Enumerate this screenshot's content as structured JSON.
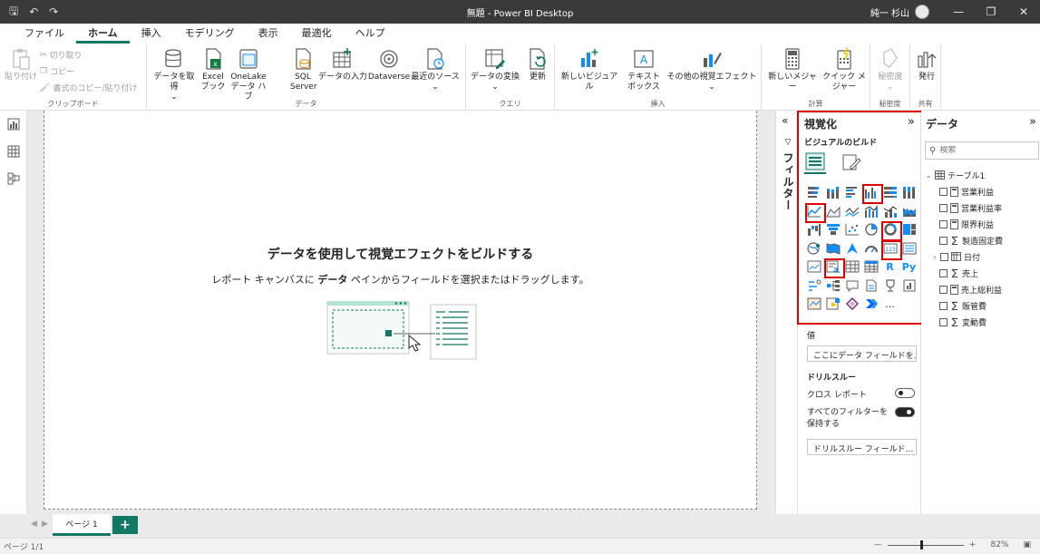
{
  "window": {
    "title": "無題 - Power BI Desktop",
    "user": "純一 杉山"
  },
  "menu": {
    "tabs": [
      "ファイル",
      "ホーム",
      "挿入",
      "モデリング",
      "表示",
      "最適化",
      "ヘルプ"
    ],
    "active": "ホーム"
  },
  "ribbon": {
    "clipboard": {
      "group": "クリップボード",
      "paste": "貼り付け",
      "cut": "切り取り",
      "copy": "コピー",
      "format_painter": "書式のコピー/貼り付け"
    },
    "data": {
      "group": "データ",
      "get_data": "データを取得",
      "excel": "Excel ブック",
      "onelake": "OneLake データ ハブ",
      "sql": "SQL Server",
      "enter_data": "データの入力",
      "dataverse": "Dataverse",
      "recent": "最近のソース"
    },
    "query": {
      "group": "クエリ",
      "transform": "データの変換",
      "refresh": "更新"
    },
    "insert": {
      "group": "挿入",
      "new_visual": "新しいビジュアル",
      "text_box": "テキスト ボックス",
      "more_visuals": "その他の視覚エフェクト"
    },
    "calc": {
      "group": "計算",
      "new_measure": "新しいメジャー",
      "quick_measure": "クイック メジャー"
    },
    "sensitivity": {
      "group": "秘密度",
      "label": "秘密度"
    },
    "share": {
      "group": "共有",
      "publish": "発行"
    }
  },
  "canvas": {
    "empty_title": "データを使用して視覚エフェクトをビルドする",
    "empty_sub_1": "レポート キャンバスに ",
    "empty_sub_bold": "データ",
    "empty_sub_2": " ペインからフィールドを選択またはドラッグします。"
  },
  "filters": {
    "label": "フィルター"
  },
  "visualizations": {
    "title": "視覚化",
    "build_label": "ビジュアルのビルド",
    "values_label": "値",
    "values_placeholder": "ここにデータ フィールドを...",
    "drillthrough_label": "ドリルスルー",
    "cross_report": "クロス レポート",
    "keep_filters": "すべてのフィルターを保持する",
    "drill_placeholder": "ドリルスルー フィールド...",
    "cross_report_on": false,
    "keep_filters_on": true,
    "r_glyph": "R",
    "py_glyph": "Py",
    "more": "..."
  },
  "data": {
    "title": "データ",
    "search_placeholder": "検索",
    "table": "テーブル1",
    "fields": [
      {
        "name": "営業利益",
        "type": "calc"
      },
      {
        "name": "営業利益率",
        "type": "calc"
      },
      {
        "name": "限界利益",
        "type": "calc"
      },
      {
        "name": "製造固定費",
        "type": "sum"
      },
      {
        "name": "日付",
        "type": "date"
      },
      {
        "name": "売上",
        "type": "sum"
      },
      {
        "name": "売上総利益",
        "type": "calc"
      },
      {
        "name": "販管費",
        "type": "sum"
      },
      {
        "name": "変動費",
        "type": "sum"
      }
    ]
  },
  "pages": {
    "tab": "ページ 1",
    "add": "+"
  },
  "status": {
    "page": "ページ 1/1",
    "zoom": "82%"
  },
  "colors": {
    "accent": "#117865",
    "highlight": "#e00000",
    "visual_blue": "#118dff"
  }
}
